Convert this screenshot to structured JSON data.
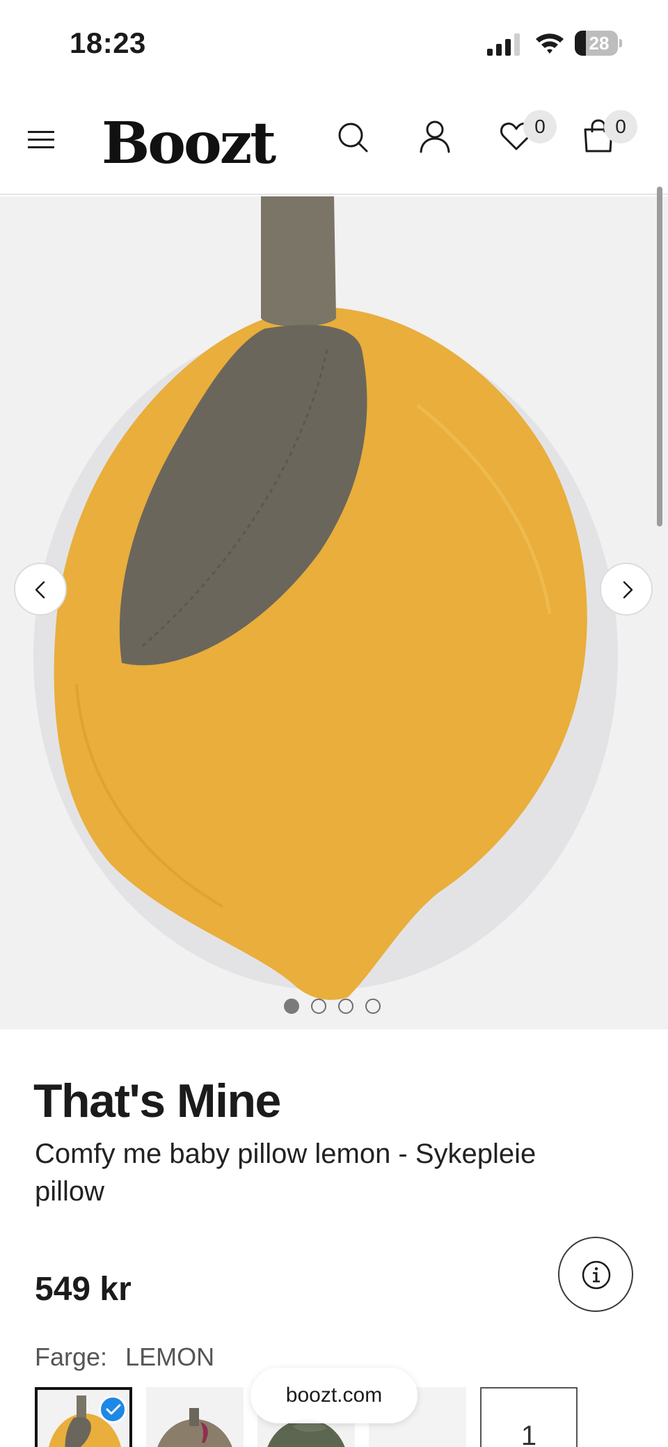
{
  "status_bar": {
    "time": "18:23",
    "battery_level": "28",
    "icons": [
      "signal-icon",
      "wifi-icon",
      "battery-icon"
    ]
  },
  "header": {
    "logo": "Boozt",
    "wishlist_count": "0",
    "cart_count": "0",
    "icons": [
      "menu-icon",
      "search-icon",
      "account-icon",
      "heart-icon",
      "bag-icon"
    ]
  },
  "gallery": {
    "image_count": 4,
    "active_index": 0,
    "icons": [
      "chevron-left-icon",
      "chevron-right-icon"
    ]
  },
  "product": {
    "brand": "That's Mine",
    "title": "Comfy me baby pillow lemon - Sykepleie pillow",
    "price": "549 kr",
    "color_label": "Farge:",
    "color_value": "LEMON",
    "more_swatches_label": "1"
  },
  "browser": {
    "url": "boozt.com"
  },
  "colors": {
    "lemon": "#e9ae3b",
    "leaf": "#6b665b",
    "selected_check": "#1e88e5",
    "text": "#1b1b1b"
  }
}
